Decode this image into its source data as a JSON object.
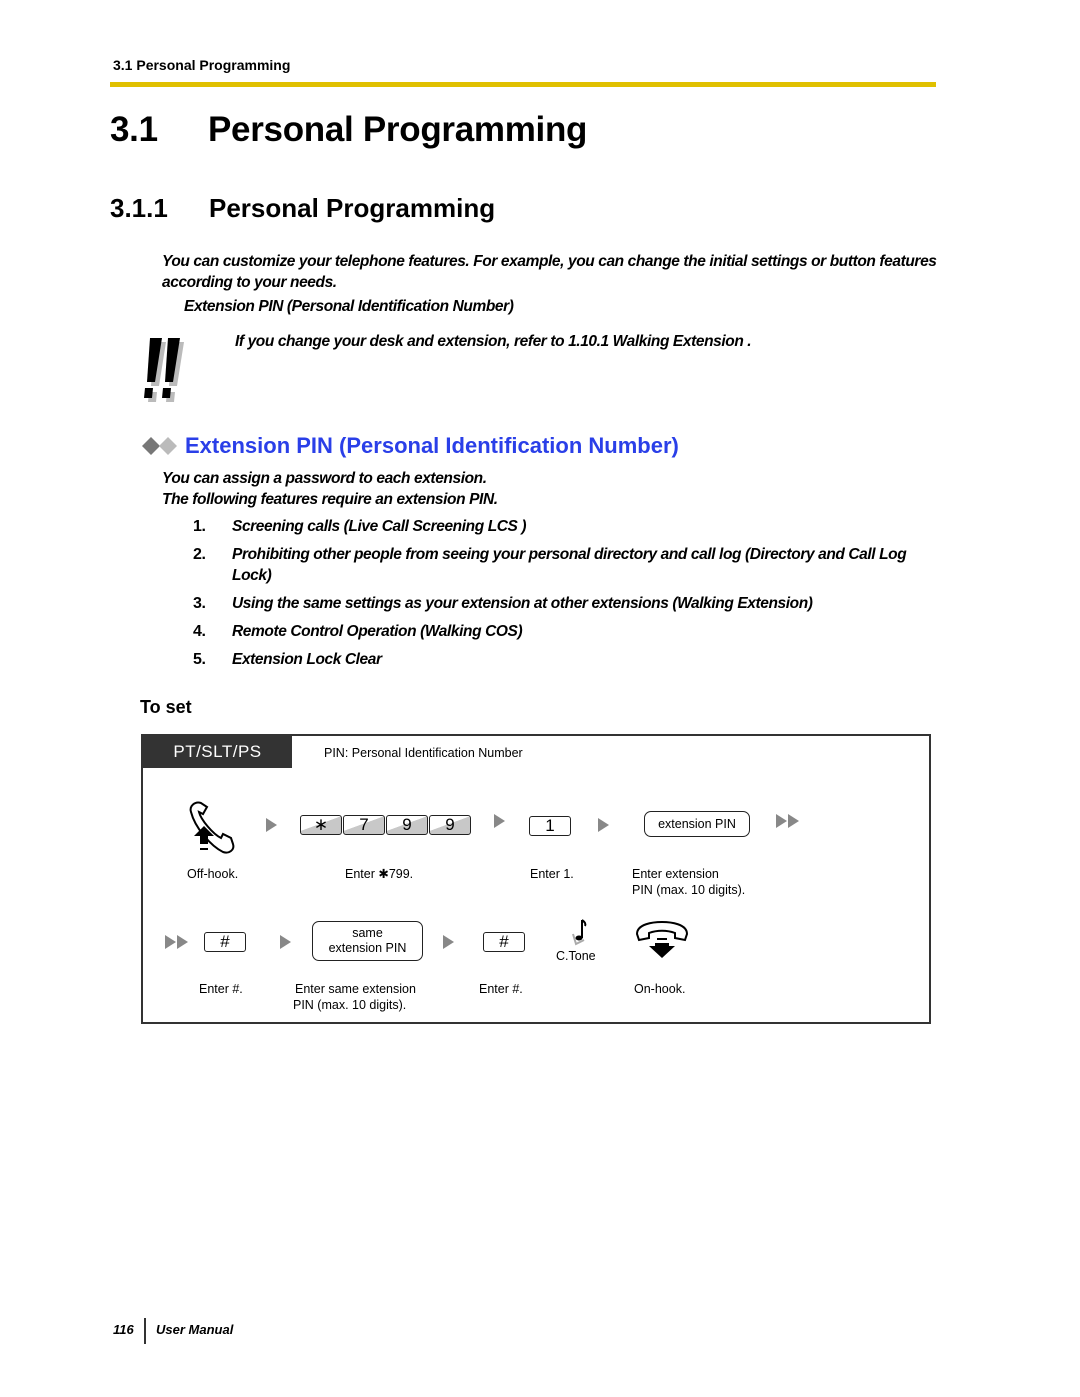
{
  "running_head": "3.1 Personal Programming",
  "section": {
    "number": "3.1",
    "title": "Personal Programming"
  },
  "subsection": {
    "number": "3.1.1",
    "title": "Personal Programming"
  },
  "intro": {
    "text": "You can customize your telephone features. For example, you can change the initial settings or button features according to your needs.",
    "link": "Extension PIN (Personal Identification Number)"
  },
  "note": {
    "icon": "double-exclamation-icon",
    "text": "If you change your desk and extension, refer to  1.10.1 Walking Extension ."
  },
  "feature": {
    "icon": "double-diamond-icon",
    "heading": "Extension PIN (Personal Identification Number)",
    "heading_color": "#2a3fe8",
    "description_lines": [
      "You can assign a password to each extension.",
      "The following features require an extension PIN."
    ],
    "items": [
      {
        "num": "1.",
        "text": "Screening calls (Live Call Screening  LCS )"
      },
      {
        "num": "2.",
        "text": "Prohibiting other people from seeing your personal directory and call log (Directory and Call Log Lock)"
      },
      {
        "num": "3.",
        "text": "Using the same settings as your extension at other extensions (Walking Extension)"
      },
      {
        "num": "4.",
        "text": "Remote Control Operation (Walking COS)"
      },
      {
        "num": "5.",
        "text": "Extension Lock Clear"
      }
    ]
  },
  "procedure": {
    "heading": "To set",
    "device_tag": "PT/SLT/PS",
    "pin_note": "PIN: Personal Identification Number",
    "row1": {
      "offhook_caption": "Off-hook.",
      "keys": [
        "∗",
        "7",
        "9",
        "9"
      ],
      "keys_caption": "Enter ✱799.",
      "key_one": "1",
      "key_one_caption": "Enter 1.",
      "pin_box": "extension PIN",
      "pin_caption_1": "Enter extension",
      "pin_caption_2": "PIN (max. 10 digits)."
    },
    "row2": {
      "hash_key": "#",
      "hash_caption": "Enter #.",
      "same_box_1": "same",
      "same_box_2": "extension PIN",
      "same_caption_1": "Enter same extension",
      "same_caption_2": "PIN (max. 10 digits).",
      "hash2_key": "#",
      "hash2_caption": "Enter #.",
      "tone_label": "C.Tone",
      "onhook_caption": "On-hook."
    }
  },
  "footer": {
    "page": "116",
    "title": "User Manual"
  },
  "colors": {
    "rule": "#e0c000",
    "tag_bg": "#333333"
  }
}
